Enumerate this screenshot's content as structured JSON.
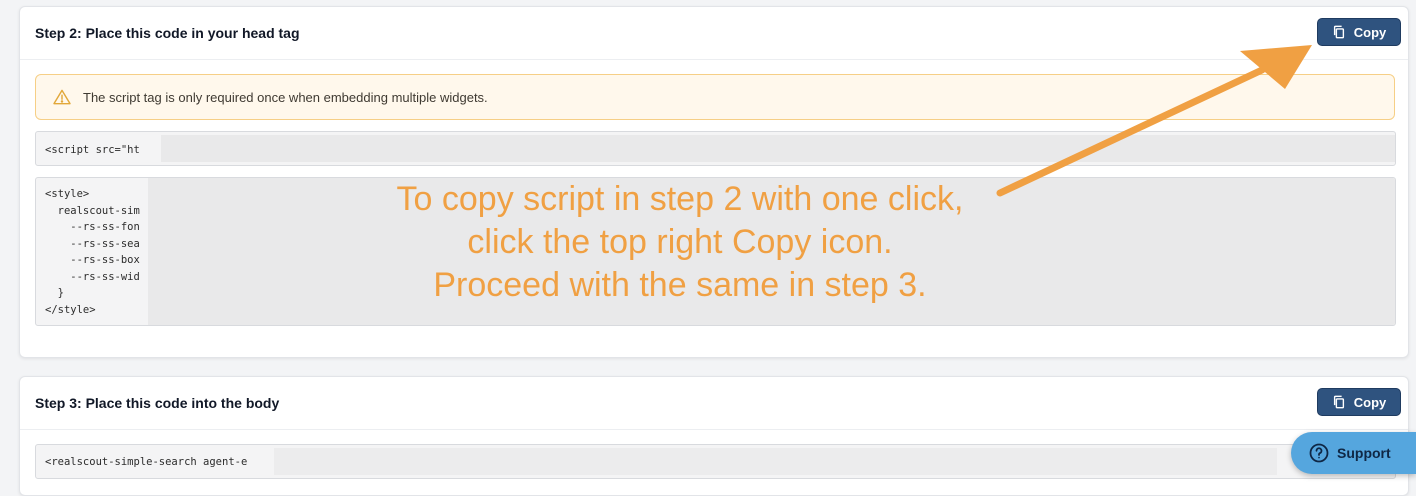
{
  "step2": {
    "title": "Step 2: Place this code in your head tag",
    "copy_label": "Copy",
    "alert_text": "The script tag is only required once when embedding multiple widgets.",
    "script_code": "<script src=\"ht",
    "style_code": "<style>\n  realscout-sim\n    --rs-ss-fon\n    --rs-ss-sea\n    --rs-ss-box\n    --rs-ss-wid\n  }\n</style>"
  },
  "step3": {
    "title": "Step 3: Place this code into the body",
    "copy_label": "Copy",
    "body_code": "<realscout-simple-search agent-e"
  },
  "annotation": {
    "line1": "To copy script in step 2 with one click,",
    "line2": "click the top right Copy icon.",
    "line3": "Proceed with the same in step 3."
  },
  "support": {
    "label": "Support"
  },
  "colors": {
    "accent_button": "#2f537f",
    "alert_bg": "#fff8ec",
    "alert_border": "#f6cf86",
    "annotation": "#f0a043",
    "support_button": "#55a6de"
  },
  "icons": {
    "copy": "copy-icon",
    "warning": "warning-icon",
    "help": "help-circle-icon"
  }
}
